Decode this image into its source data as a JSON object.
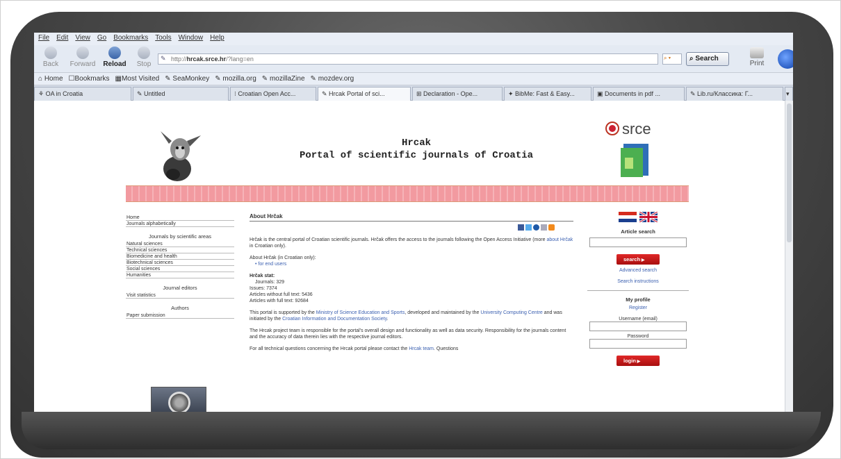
{
  "browser": {
    "menu": [
      "File",
      "Edit",
      "View",
      "Go",
      "Bookmarks",
      "Tools",
      "Window",
      "Help"
    ],
    "nav": {
      "back": "Back",
      "forward": "Forward",
      "reload": "Reload",
      "stop": "Stop",
      "print": "Print"
    },
    "url": {
      "prefix": "http://",
      "domain": "hrcak.srce.hr",
      "path": "/?lang=en"
    },
    "search_label": "Search",
    "bookmarks": [
      "Home",
      "Bookmarks",
      "Most Visited",
      "SeaMonkey",
      "mozilla.org",
      "mozillaZine",
      "mozdev.org"
    ],
    "tabs": [
      "OA in Croatia",
      "Untitled",
      "Croatian Open Acc...",
      "Hrcak Portal of sci...",
      "Declaration - Ope...",
      "BibMe: Fast & Easy...",
      "Documents in pdf ...",
      "Lib.ru/Классика: Г..."
    ]
  },
  "header": {
    "title": "Hrcak",
    "subtitle": "Portal of scientific journals of Croatia",
    "logo_text": "srce"
  },
  "leftnav": {
    "top": [
      "Home",
      "Journals alphabetically"
    ],
    "areas_heading": "Journals by scientific areas",
    "areas": [
      "Natural sciences",
      "Technical sciences",
      "Biomedicine and health",
      "Biotechnical sciences",
      "Social sciences",
      "Humanities"
    ],
    "editors_heading": "Journal editors",
    "editors": [
      "Visit statistics"
    ],
    "authors_heading": "Authors",
    "authors": [
      "Paper submission"
    ]
  },
  "main": {
    "heading": "About Hrčak",
    "intro_a": "Hrčak is the central portal of Croatian scientific journals. Hrčak offers the access to the journals following the Open Access Initiative (more ",
    "intro_link": "about Hrčak",
    "intro_b": " in Croatian only).",
    "about_line": "About Hrčak (in Croatian only):",
    "about_link": "• for end users",
    "stats_heading": "Hrčak stat:",
    "stats": [
      "Journals: 329",
      "Issues: 7374",
      "Articles without full text: 5436",
      "Articles with full text: 92684"
    ],
    "support_a": "This portal is supported by the ",
    "support_link1": "Ministry of Science Education and Sports",
    "support_b": ", developed and maintained by the ",
    "support_link2": "University Computing Centre",
    "support_c": " and was initiated by the ",
    "support_link3": "Croatian Information and Documentation Society",
    "support_d": ".",
    "team": "The Hrcak project team is responsible for the portal's overall design and functionality as well as data security. Responsibility for the journals content and the accuracy of data therein lies with the respective journal editors.",
    "cutoff": "For all technical questions concerning the Hrcak portal please contact the ",
    "cutoff_link": "Hrcak team",
    "cutoff_b": ". Questions"
  },
  "sidebar": {
    "article_search": "Article search",
    "search_btn": "search",
    "advanced": "Advanced search",
    "instructions": "Search instructions",
    "profile": "My profile",
    "register": "Register",
    "username": "Username (email)",
    "password": "Password",
    "login_btn": "login"
  }
}
